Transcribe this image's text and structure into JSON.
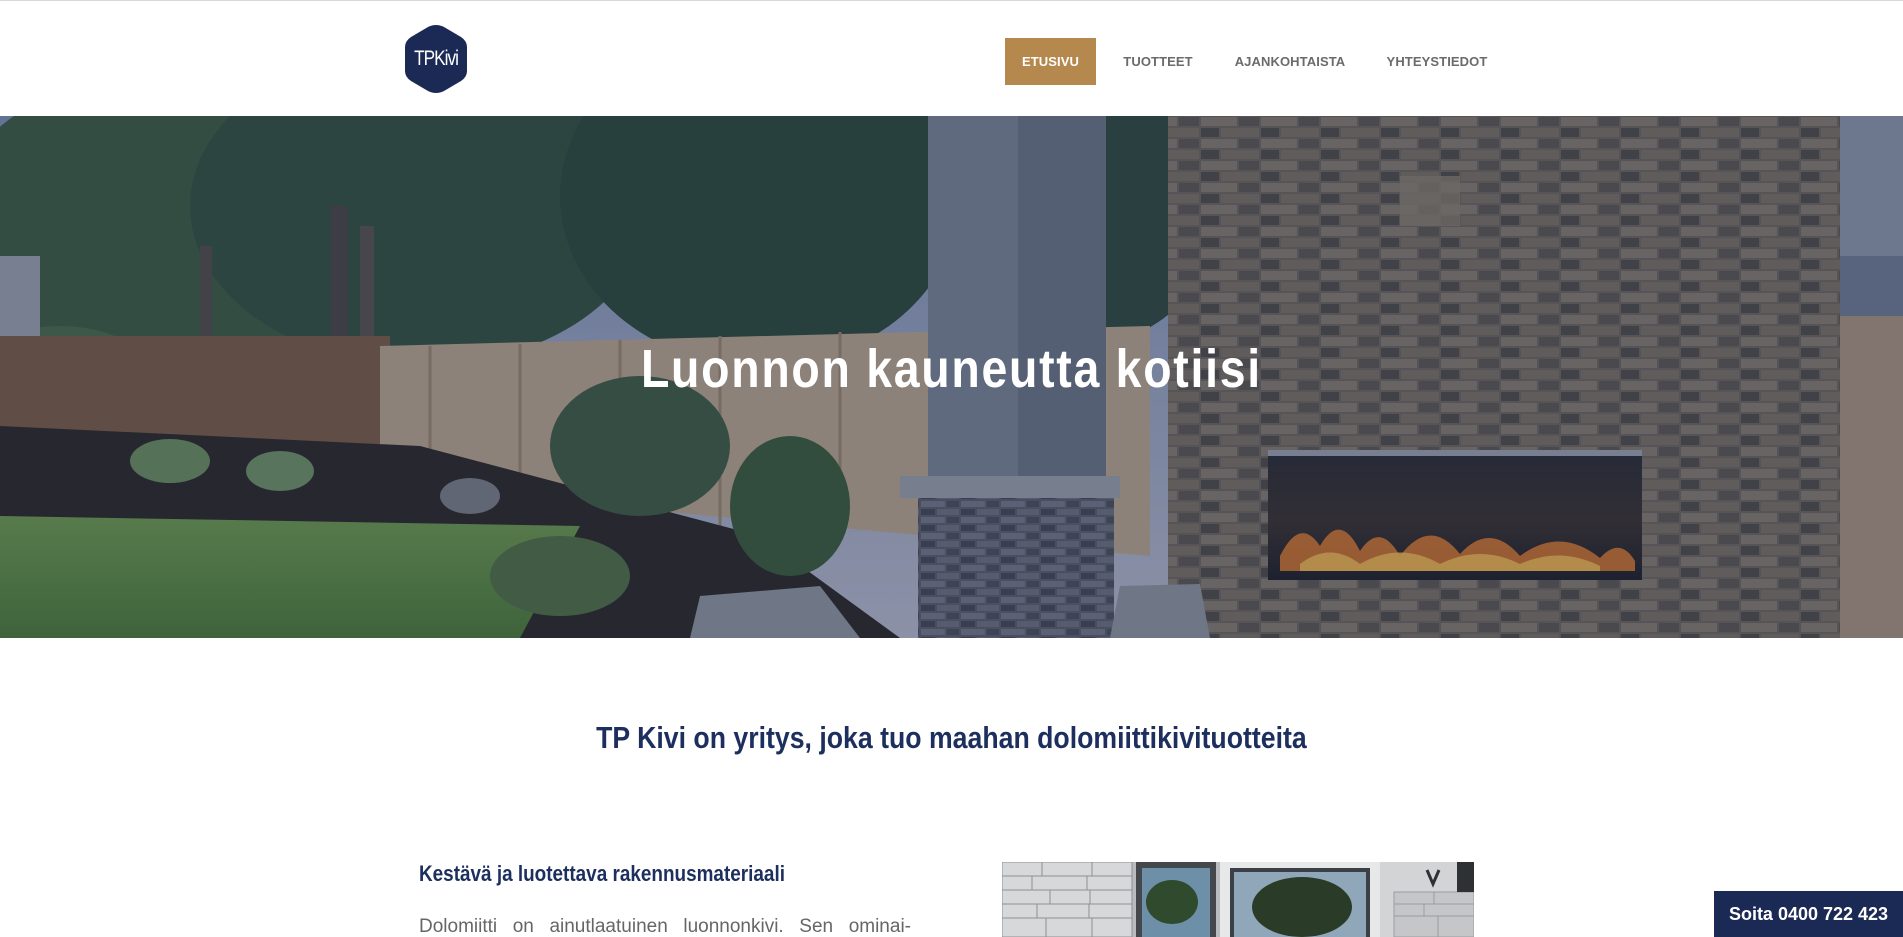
{
  "header": {
    "logo_text": "TPKivi",
    "logo_color": "#1b2a55",
    "nav": [
      {
        "label": "ETUSIVU",
        "active": true
      },
      {
        "label": "TUOTTEET",
        "active": false
      },
      {
        "label": "AJANKOHTAISTA",
        "active": false
      },
      {
        "label": "YHTEYSTIEDOT",
        "active": false
      }
    ],
    "accent_color": "#b5894e"
  },
  "hero": {
    "title": "Luonnon kauneutta kotiisi"
  },
  "intro": {
    "heading": "TP Kivi on yritys, joka tuo maahan dolomiittikivituotteita"
  },
  "feature": {
    "heading": "Kestävä ja luotettava rakennusmateriaali",
    "text": "Dolomiitti on ainutlaatuinen luonnonkivi. Sen ominai-"
  },
  "call_button": {
    "label": "Soita 0400 722 423",
    "color": "#1b2a55"
  }
}
